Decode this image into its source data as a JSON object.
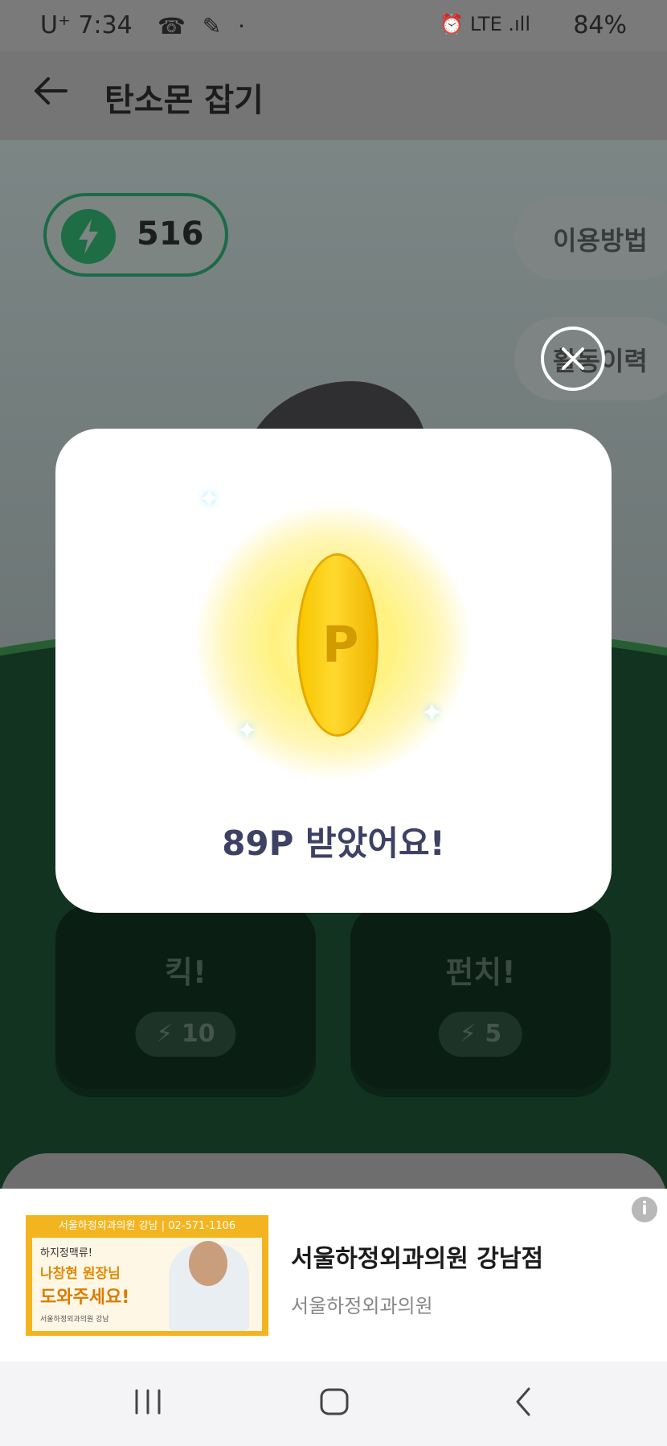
{
  "status_bar": {
    "carrier_time": "U⁺ 7:34",
    "battery": "84%",
    "notif_icons": "☎ ✎ ·",
    "signal_icons": "⏰ LTE .ıll"
  },
  "header": {
    "title": "탄소몬 잡기",
    "back_icon": "arrow-left-icon"
  },
  "game": {
    "energy": "516",
    "how_to_label": "이용방법",
    "history_label": "활동이력",
    "actions": [
      {
        "label": "킥!",
        "cost": "10"
      },
      {
        "label": "펀치!",
        "cost": "5"
      }
    ]
  },
  "modal": {
    "title": "89P 받았어요!",
    "coin_letter": "P"
  },
  "ad": {
    "banner_top": "서울하정외과의원 강남 | 02-571-1106",
    "banner_line1": "하지정맥류!",
    "banner_line2": "나창현 원장님",
    "banner_line3": "도와주세요!",
    "banner_logo": "서울하정외과의원 강남",
    "title": "서울하정외과의원 강남점",
    "subtitle": "서울하정외과의원",
    "info_icon": "i"
  },
  "colors": {
    "accent_green": "#1e6d45",
    "modal_title": "#3d4264",
    "ad_orange": "#f3b51f"
  }
}
